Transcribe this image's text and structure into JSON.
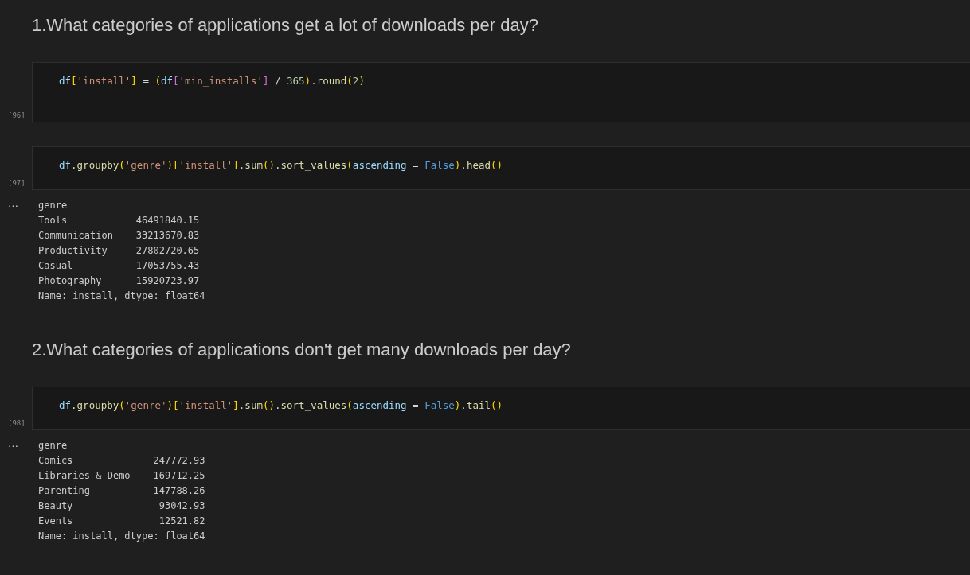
{
  "cells": [
    {
      "kind": "markdown",
      "text": "1.What categories of applications get a lot of downloads per day?"
    },
    {
      "kind": "code",
      "count": "[96]",
      "tall": true,
      "tokens": [
        {
          "kind": "var",
          "t": "df"
        },
        {
          "kind": "b1",
          "t": "["
        },
        {
          "kind": "str",
          "t": "'install'"
        },
        {
          "kind": "b1",
          "t": "]"
        },
        {
          "kind": "op",
          "t": " = "
        },
        {
          "kind": "b1",
          "t": "("
        },
        {
          "kind": "var",
          "t": "df"
        },
        {
          "kind": "b2",
          "t": "["
        },
        {
          "kind": "str",
          "t": "'min_installs'"
        },
        {
          "kind": "b2",
          "t": "]"
        },
        {
          "kind": "op",
          "t": " / "
        },
        {
          "kind": "num",
          "t": "365"
        },
        {
          "kind": "b1",
          "t": ")"
        },
        {
          "kind": "punc",
          "t": "."
        },
        {
          "kind": "func",
          "t": "round"
        },
        {
          "kind": "b1",
          "t": "("
        },
        {
          "kind": "num",
          "t": "2"
        },
        {
          "kind": "b1",
          "t": ")"
        }
      ]
    },
    {
      "kind": "code",
      "count": "[97]",
      "tall": false,
      "tokens": [
        {
          "kind": "var",
          "t": "df"
        },
        {
          "kind": "punc",
          "t": "."
        },
        {
          "kind": "func",
          "t": "groupby"
        },
        {
          "kind": "b1",
          "t": "("
        },
        {
          "kind": "str",
          "t": "'genre'"
        },
        {
          "kind": "b1",
          "t": ")"
        },
        {
          "kind": "b1",
          "t": "["
        },
        {
          "kind": "str",
          "t": "'install'"
        },
        {
          "kind": "b1",
          "t": "]"
        },
        {
          "kind": "punc",
          "t": "."
        },
        {
          "kind": "func",
          "t": "sum"
        },
        {
          "kind": "b1",
          "t": "()"
        },
        {
          "kind": "punc",
          "t": "."
        },
        {
          "kind": "func",
          "t": "sort_values"
        },
        {
          "kind": "b1",
          "t": "("
        },
        {
          "kind": "var",
          "t": "ascending"
        },
        {
          "kind": "op",
          "t": " = "
        },
        {
          "kind": "kw",
          "t": "False"
        },
        {
          "kind": "b1",
          "t": ")"
        },
        {
          "kind": "punc",
          "t": "."
        },
        {
          "kind": "func",
          "t": "head"
        },
        {
          "kind": "b1",
          "t": "()"
        }
      ],
      "output": {
        "marker": "…",
        "lines": [
          "genre",
          "Tools            46491840.15",
          "Communication    33213670.83",
          "Productivity     27802720.65",
          "Casual           17053755.43",
          "Photography      15920723.97",
          "Name: install, dtype: float64"
        ]
      }
    },
    {
      "kind": "markdown",
      "text": "2.What categories of applications don't get many downloads per day?"
    },
    {
      "kind": "code",
      "count": "[98]",
      "tall": false,
      "tokens": [
        {
          "kind": "var",
          "t": "df"
        },
        {
          "kind": "punc",
          "t": "."
        },
        {
          "kind": "func",
          "t": "groupby"
        },
        {
          "kind": "b1",
          "t": "("
        },
        {
          "kind": "str",
          "t": "'genre'"
        },
        {
          "kind": "b1",
          "t": ")"
        },
        {
          "kind": "b1",
          "t": "["
        },
        {
          "kind": "str",
          "t": "'install'"
        },
        {
          "kind": "b1",
          "t": "]"
        },
        {
          "kind": "punc",
          "t": "."
        },
        {
          "kind": "func",
          "t": "sum"
        },
        {
          "kind": "b1",
          "t": "()"
        },
        {
          "kind": "punc",
          "t": "."
        },
        {
          "kind": "func",
          "t": "sort_values"
        },
        {
          "kind": "b1",
          "t": "("
        },
        {
          "kind": "var",
          "t": "ascending"
        },
        {
          "kind": "op",
          "t": " = "
        },
        {
          "kind": "kw",
          "t": "False"
        },
        {
          "kind": "b1",
          "t": ")"
        },
        {
          "kind": "punc",
          "t": "."
        },
        {
          "kind": "func",
          "t": "tail"
        },
        {
          "kind": "b1",
          "t": "()"
        }
      ],
      "output": {
        "marker": "…",
        "lines": [
          "genre",
          "Comics              247772.93",
          "Libraries & Demo    169712.25",
          "Parenting           147788.26",
          "Beauty               93042.93",
          "Events               12521.82",
          "Name: install, dtype: float64"
        ]
      }
    }
  ]
}
